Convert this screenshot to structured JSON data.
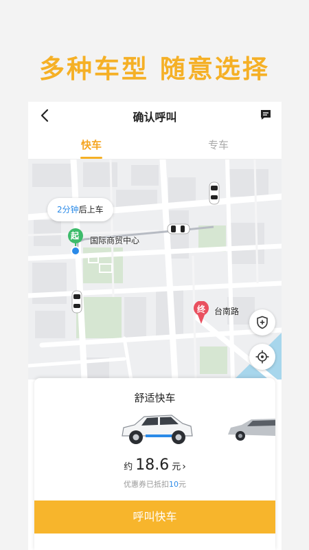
{
  "promo": {
    "headline": "多种车型 随意选择"
  },
  "header": {
    "title": "确认呼叫",
    "back_icon": "chevron-left-icon",
    "message_icon": "message-icon"
  },
  "tabs": [
    {
      "label": "快车",
      "active": true
    },
    {
      "label": "专车",
      "active": false
    }
  ],
  "map": {
    "eta_prefix": "2分钟",
    "eta_suffix": "后上车",
    "start_marker": "起",
    "start_label": "国际商贸中心",
    "end_marker": "终",
    "end_label": "台南路"
  },
  "card": {
    "title": "舒适快车",
    "price_prefix": "约",
    "price": "18.6",
    "price_unit": "元",
    "price_arrow": "›",
    "coupon_prefix": "优惠券已抵扣",
    "coupon_amount": "10",
    "coupon_unit": "元",
    "call_button": "呼叫快车"
  },
  "colors": {
    "accent": "#f5b026",
    "link_blue": "#2a8ae8",
    "start_green": "#3dbb6b",
    "end_red": "#e9505f"
  }
}
